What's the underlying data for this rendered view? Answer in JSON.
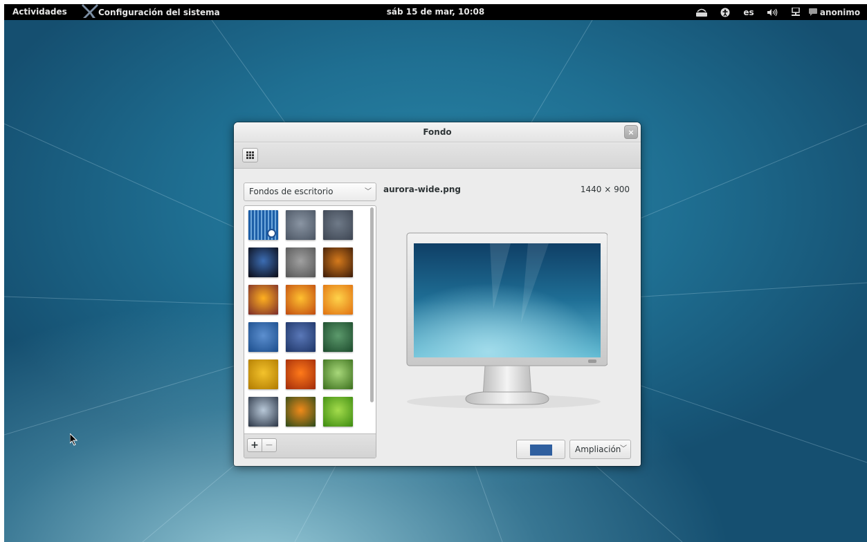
{
  "topbar": {
    "activities": "Actividades",
    "app_menu": "Configuración del sistema",
    "clock": "sáb 15 de mar, 10:08",
    "keyboard_layout": "es",
    "user": "anonimo"
  },
  "window": {
    "title": "Fondo",
    "close_glyph": "×",
    "category": "Fondos de escritorio",
    "file_name": "aurora-wide.png",
    "dimensions": "1440 × 900",
    "add_glyph": "+",
    "remove_glyph": "−",
    "color_value": "#2f5f9f",
    "zoom_mode": "Ampliación"
  },
  "wallpapers": [
    {
      "name": "blue-stripes-selected",
      "colors": [
        "#1d5fa8",
        "#6fa8dc"
      ]
    },
    {
      "name": "gray-swirl",
      "colors": [
        "#4a5462",
        "#8a95a3"
      ]
    },
    {
      "name": "gray-gear",
      "colors": [
        "#3d4552",
        "#6f7a88"
      ]
    },
    {
      "name": "earth",
      "colors": [
        "#0a0a14",
        "#3c6db3"
      ]
    },
    {
      "name": "gray-drops",
      "colors": [
        "#555555",
        "#a0a0a0"
      ]
    },
    {
      "name": "desert-sunset",
      "colors": [
        "#3a1a08",
        "#d57a1c"
      ]
    },
    {
      "name": "orange-flare-1",
      "colors": [
        "#7a2a2a",
        "#ffb020"
      ]
    },
    {
      "name": "orange-flare-2",
      "colors": [
        "#c04a10",
        "#ffc030"
      ]
    },
    {
      "name": "orange-flare-3",
      "colors": [
        "#e07010",
        "#ffd34a"
      ]
    },
    {
      "name": "blue-lines",
      "colors": [
        "#1b4d8c",
        "#5c8fcf"
      ]
    },
    {
      "name": "blue-radial",
      "colors": [
        "#1d3466",
        "#5a78b8"
      ]
    },
    {
      "name": "green-radial",
      "colors": [
        "#1c4a2c",
        "#5c9a6c"
      ]
    },
    {
      "name": "yellow-radial",
      "colors": [
        "#b07a00",
        "#f3c22c"
      ]
    },
    {
      "name": "red-flower",
      "colors": [
        "#a02a0a",
        "#ff7a1a"
      ]
    },
    {
      "name": "green-grass",
      "colors": [
        "#3a6e1c",
        "#a8d87a"
      ]
    },
    {
      "name": "water-drop",
      "colors": [
        "#2a3444",
        "#b8c8d8"
      ]
    },
    {
      "name": "orange-blur",
      "colors": [
        "#2a4a1a",
        "#f08a1a"
      ]
    },
    {
      "name": "green-leaf",
      "colors": [
        "#3c8a10",
        "#a4dc4c"
      ]
    }
  ]
}
